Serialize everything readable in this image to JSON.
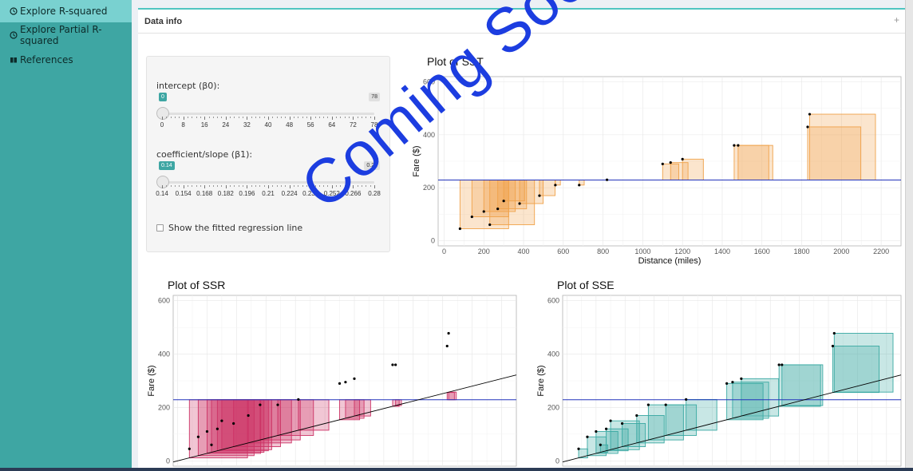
{
  "sidebar": {
    "items": [
      {
        "label": "Explore R-squared",
        "icon": "history-icon",
        "active": true
      },
      {
        "label": "Explore Partial R-squared",
        "icon": "history-icon",
        "active": false
      },
      {
        "label": "References",
        "icon": "book-icon",
        "active": false
      }
    ]
  },
  "box": {
    "title": "Data info",
    "collapse_symbol": "+"
  },
  "controls": {
    "intercept": {
      "label": "intercept (β0):",
      "value": "0",
      "max_badge": "78",
      "ticks": [
        "0",
        "8",
        "16",
        "24",
        "32",
        "40",
        "48",
        "56",
        "64",
        "72",
        "78"
      ]
    },
    "slope": {
      "label": "coefficient/slope (β1):",
      "value": "0.14",
      "max_badge": "0.28",
      "ticks": [
        "0.14",
        "0.154",
        "0.168",
        "0.182",
        "0.196",
        "0.21",
        "0.224",
        "0.238",
        "0.252",
        "0.266",
        "0.28"
      ]
    },
    "checkbox_label": "Show the fitted regression line",
    "checkbox_checked": false
  },
  "overlay_text": "Coming Soon!",
  "colors": {
    "sidebar": "#3ea6a3",
    "accent": "#4fc5c1",
    "sst": "#f0a24a",
    "ssr": "#cc3366",
    "sse": "#3aa9a3",
    "mean_line": "#2233bb",
    "overlay": "#1c3de0"
  },
  "chart_data": [
    {
      "type": "scatter",
      "title": "Plot of SST",
      "xlabel": "Distance (miles)",
      "ylabel": "Fare ($)",
      "xlim": [
        -30,
        2300
      ],
      "ylim": [
        -20,
        620
      ],
      "x_ticks": [
        "0",
        "200",
        "400",
        "600",
        "800",
        "1000",
        "1200",
        "1400",
        "1600",
        "1800",
        "2000",
        "2200"
      ],
      "y_ticks": [
        "0",
        "200",
        "400",
        "600"
      ],
      "mean_fare": 229,
      "series": [
        {
          "x": [
            80,
            140,
            200,
            230,
            270,
            300,
            380,
            480,
            560,
            680,
            820,
            1100,
            1140,
            1200,
            1460,
            1480,
            1830,
            1840
          ],
          "y": [
            45,
            90,
            110,
            60,
            120,
            150,
            140,
            170,
            210,
            210,
            230,
            290,
            295,
            308,
            360,
            360,
            430,
            478
          ]
        }
      ]
    },
    {
      "type": "scatter",
      "title": "Plot of SSR",
      "xlabel": "",
      "ylabel": "Fare ($)",
      "xlim": [
        -30,
        2300
      ],
      "ylim": [
        -20,
        620
      ],
      "y_ticks": [
        "0",
        "200",
        "400",
        "600"
      ],
      "mean_fare": 229,
      "intercept": 0,
      "slope": 0.14,
      "series": [
        {
          "x": [
            80,
            140,
            200,
            230,
            270,
            300,
            380,
            480,
            560,
            680,
            820,
            1100,
            1140,
            1200,
            1460,
            1480,
            1830,
            1840
          ],
          "y": [
            45,
            90,
            110,
            60,
            120,
            150,
            140,
            170,
            210,
            210,
            230,
            290,
            295,
            308,
            360,
            360,
            430,
            478
          ]
        }
      ]
    },
    {
      "type": "scatter",
      "title": "Plot of SSE",
      "xlabel": "",
      "ylabel": "Fare ($)",
      "xlim": [
        -30,
        2300
      ],
      "ylim": [
        -20,
        620
      ],
      "y_ticks": [
        "0",
        "200",
        "400",
        "600"
      ],
      "mean_fare": 229,
      "intercept": 0,
      "slope": 0.14,
      "series": [
        {
          "x": [
            80,
            140,
            200,
            230,
            270,
            300,
            380,
            480,
            560,
            680,
            820,
            1100,
            1140,
            1200,
            1460,
            1480,
            1830,
            1840
          ],
          "y": [
            45,
            90,
            110,
            60,
            120,
            150,
            140,
            170,
            210,
            210,
            230,
            290,
            295,
            308,
            360,
            360,
            430,
            478
          ]
        }
      ]
    }
  ]
}
